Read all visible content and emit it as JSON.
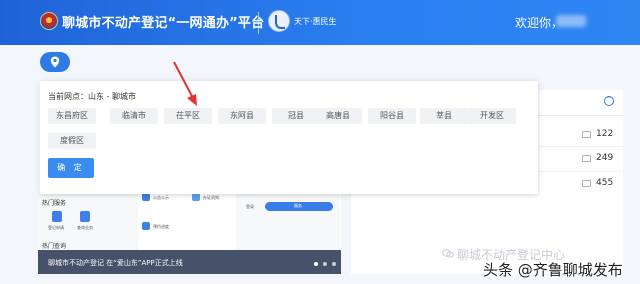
{
  "header": {
    "site_title": "聊城市不动产登记“一网通办”平台",
    "partner_logo_text": "天下·惠民生",
    "welcome_label": "欢迎你，"
  },
  "popup": {
    "title": "当前网点：山东 - 聊城市",
    "regions": [
      "东昌府区",
      "临清市",
      "茌平区",
      "东阿县",
      "冠县",
      "高唐县",
      "阳谷县",
      "莘县",
      "开发区",
      "度假区"
    ],
    "confirm_label": "确 定"
  },
  "background": {
    "hot_services_label": "热门服务",
    "hot_query_label": "热门查询",
    "item_a": "登记申请",
    "item_b": "查询业务",
    "item_c": "公告公示",
    "item_d": "办证须知",
    "item_e": "预约进度",
    "item_f": "全部",
    "item_g": "服务",
    "item_h": "登录",
    "banner_text": "聊城市不动产登记 在“爱山东”APP正式上线",
    "stats": [
      "122",
      "249",
      "455"
    ]
  },
  "watermark": "聊城不动产登记中心",
  "source_credit": "头条 @齐鲁聊城发布",
  "colors": {
    "header_blue": "#2a7ef0",
    "primary_button": "#3b8cf1",
    "annotation_arrow": "#e5322d"
  }
}
